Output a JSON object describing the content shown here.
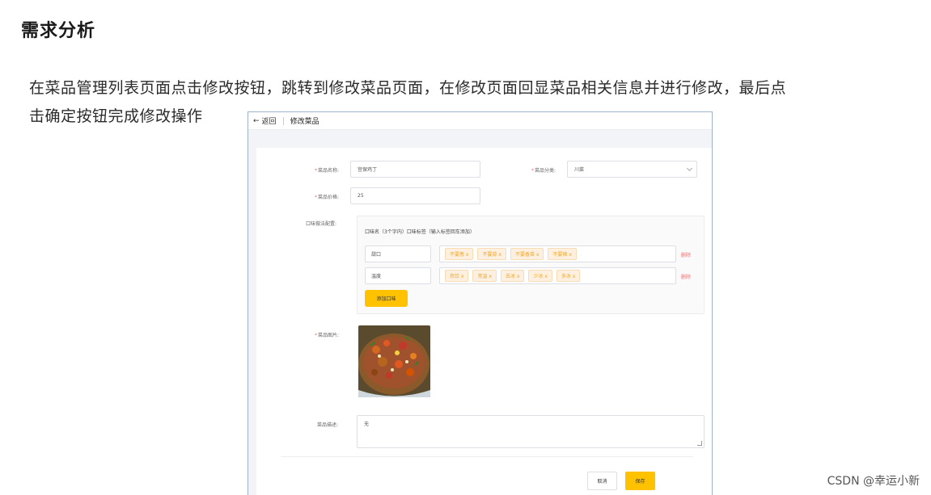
{
  "slide": {
    "heading": "需求分析",
    "paragraph_line1": "在菜品管理列表页面点击修改按钮，跳转到修改菜品页面，在修改页面回显菜品相关信息并进行修改，最后点",
    "paragraph_line2": "击确定按钮完成修改操作",
    "watermark": "CSDN @幸运小新"
  },
  "screenshot": {
    "topbar": {
      "back_label": "返回",
      "title": "修改菜品"
    },
    "form": {
      "name_label": "菜品名称:",
      "name_value": "宫保鸡丁",
      "category_label": "菜品分类:",
      "category_value": "川菜",
      "price_label": "菜品价格:",
      "price_value": "25",
      "flavor_label": "口味做法配置:",
      "flavor_hint": "口味名（3个字内）口味标签（输入标签回车添加）",
      "flavors": [
        {
          "name": "甜口",
          "tags": [
            "不要葱 x",
            "不要蒜 x",
            "不要香菜 x",
            "不要辣 x"
          ],
          "delete_label": "删除"
        },
        {
          "name": "温度",
          "tags": [
            "热饮 x",
            "常温 x",
            "去冰 x",
            "少冰 x",
            "多冰 x"
          ],
          "delete_label": "删除"
        }
      ],
      "add_flavor_label": "添加口味",
      "image_label": "菜品图片:",
      "desc_label": "菜品描述:",
      "desc_value": "无"
    },
    "buttons": {
      "cancel": "取消",
      "save": "保存"
    },
    "colors": {
      "accent": "#ffc200",
      "danger": "#f56c6c",
      "tag_text": "#f5a623"
    }
  }
}
